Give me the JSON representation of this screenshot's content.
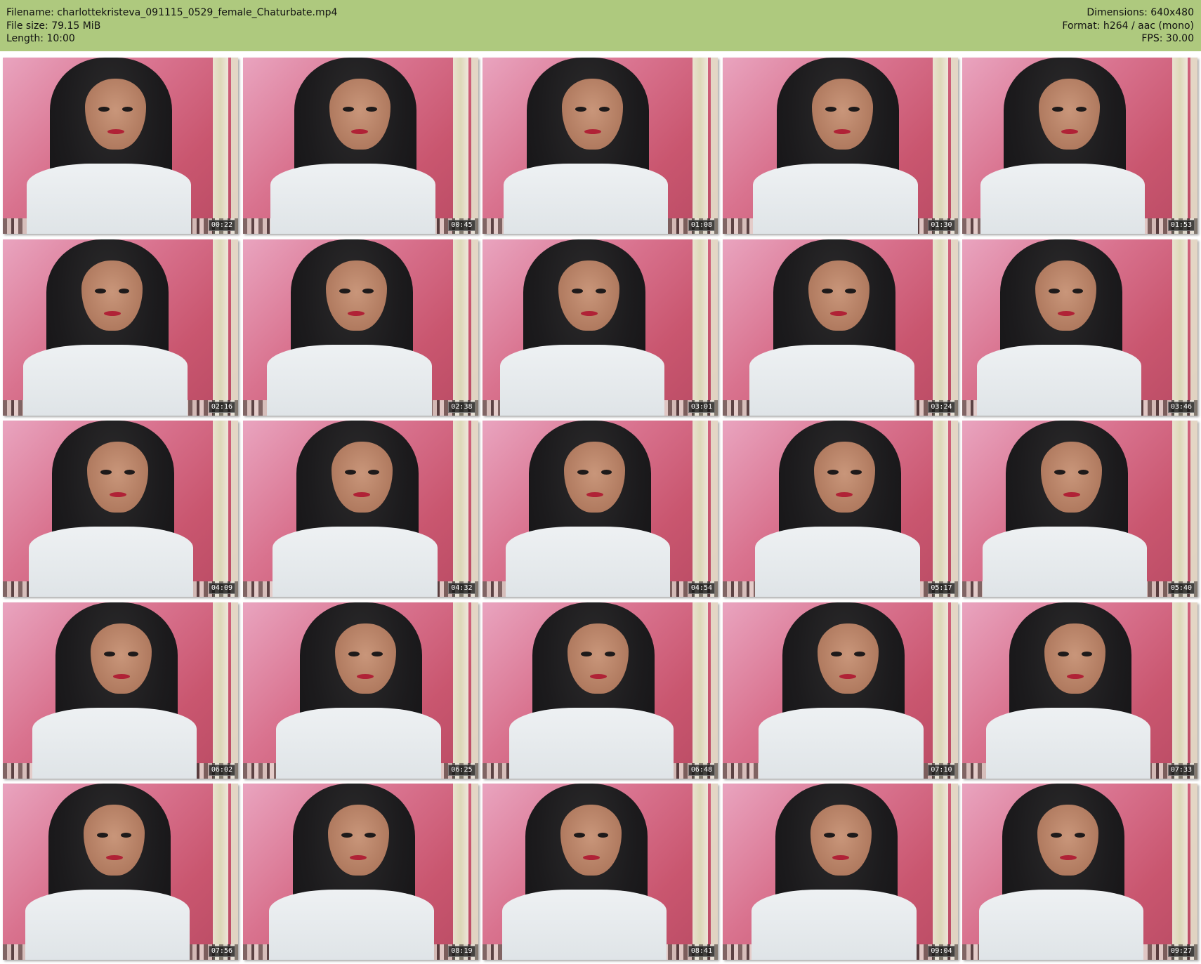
{
  "header": {
    "filename": "Filename: charlottekristeva_091115_0529_female_Chaturbate.mp4",
    "filesize": "File size: 79.15 MiB",
    "length": "Length: 10:00",
    "dimensions": "Dimensions: 640x480",
    "format": "Format: h264 / aac (mono)",
    "fps": "FPS: 30.00"
  },
  "colors": {
    "header_bg": "#aec97e",
    "page_bg": "#ffffff",
    "wall": "#d9738f"
  },
  "thumbnails": [
    {
      "timestamp": "00:22"
    },
    {
      "timestamp": "00:45"
    },
    {
      "timestamp": "01:08"
    },
    {
      "timestamp": "01:30"
    },
    {
      "timestamp": "01:53"
    },
    {
      "timestamp": "02:16"
    },
    {
      "timestamp": "02:38"
    },
    {
      "timestamp": "03:01"
    },
    {
      "timestamp": "03:24"
    },
    {
      "timestamp": "03:46"
    },
    {
      "timestamp": "04:09"
    },
    {
      "timestamp": "04:32"
    },
    {
      "timestamp": "04:54"
    },
    {
      "timestamp": "05:17"
    },
    {
      "timestamp": "05:40"
    },
    {
      "timestamp": "06:02"
    },
    {
      "timestamp": "06:25"
    },
    {
      "timestamp": "06:48"
    },
    {
      "timestamp": "07:10"
    },
    {
      "timestamp": "07:33"
    },
    {
      "timestamp": "07:56"
    },
    {
      "timestamp": "08:19"
    },
    {
      "timestamp": "08:41"
    },
    {
      "timestamp": "09:04"
    },
    {
      "timestamp": "09:27"
    }
  ]
}
